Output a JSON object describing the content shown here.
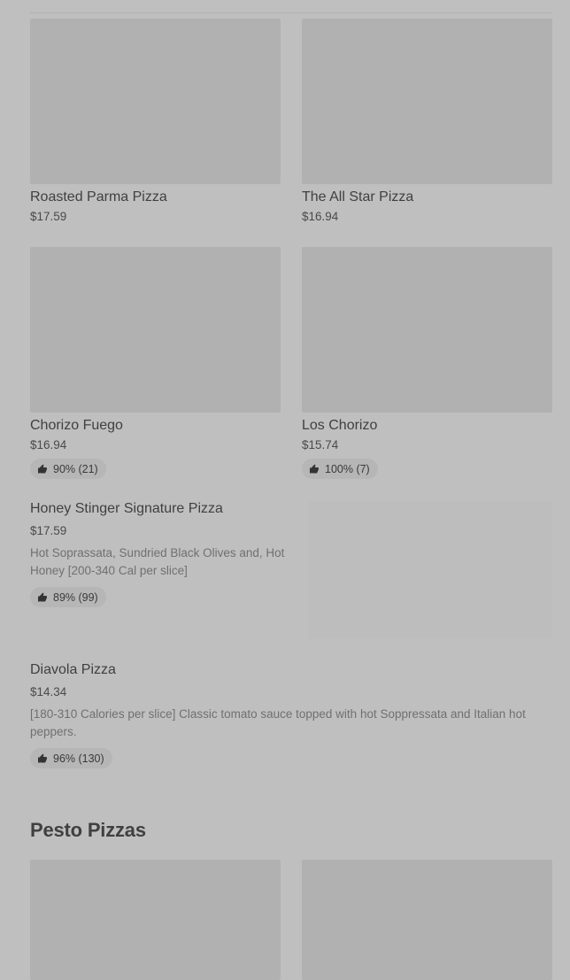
{
  "grid": [
    {
      "name": "Roasted Parma Pizza",
      "price": "$17.59"
    },
    {
      "name": "The All Star Pizza",
      "price": "$16.94"
    },
    {
      "name": "Chorizo Fuego",
      "price": "$16.94",
      "rating": "90% (21)"
    },
    {
      "name": "Los Chorizo",
      "price": "$15.74",
      "rating": "100% (7)"
    }
  ],
  "list": [
    {
      "name": "Honey Stinger Signature Pizza",
      "price": "$17.59",
      "desc": "Hot Soprassata, Sundried Black Olives and, Hot Honey [200-340 Cal per slice]",
      "rating": "89% (99)"
    },
    {
      "name": "Diavola Pizza",
      "price": "$14.34",
      "desc": "[180-310 Calories per slice] Classic tomato sauce topped with hot Soppressata and Italian hot peppers.",
      "rating": "96% (130)"
    }
  ],
  "section": {
    "title": "Pesto Pizzas"
  },
  "icons": {
    "rating": "thumbs-up-icon"
  }
}
